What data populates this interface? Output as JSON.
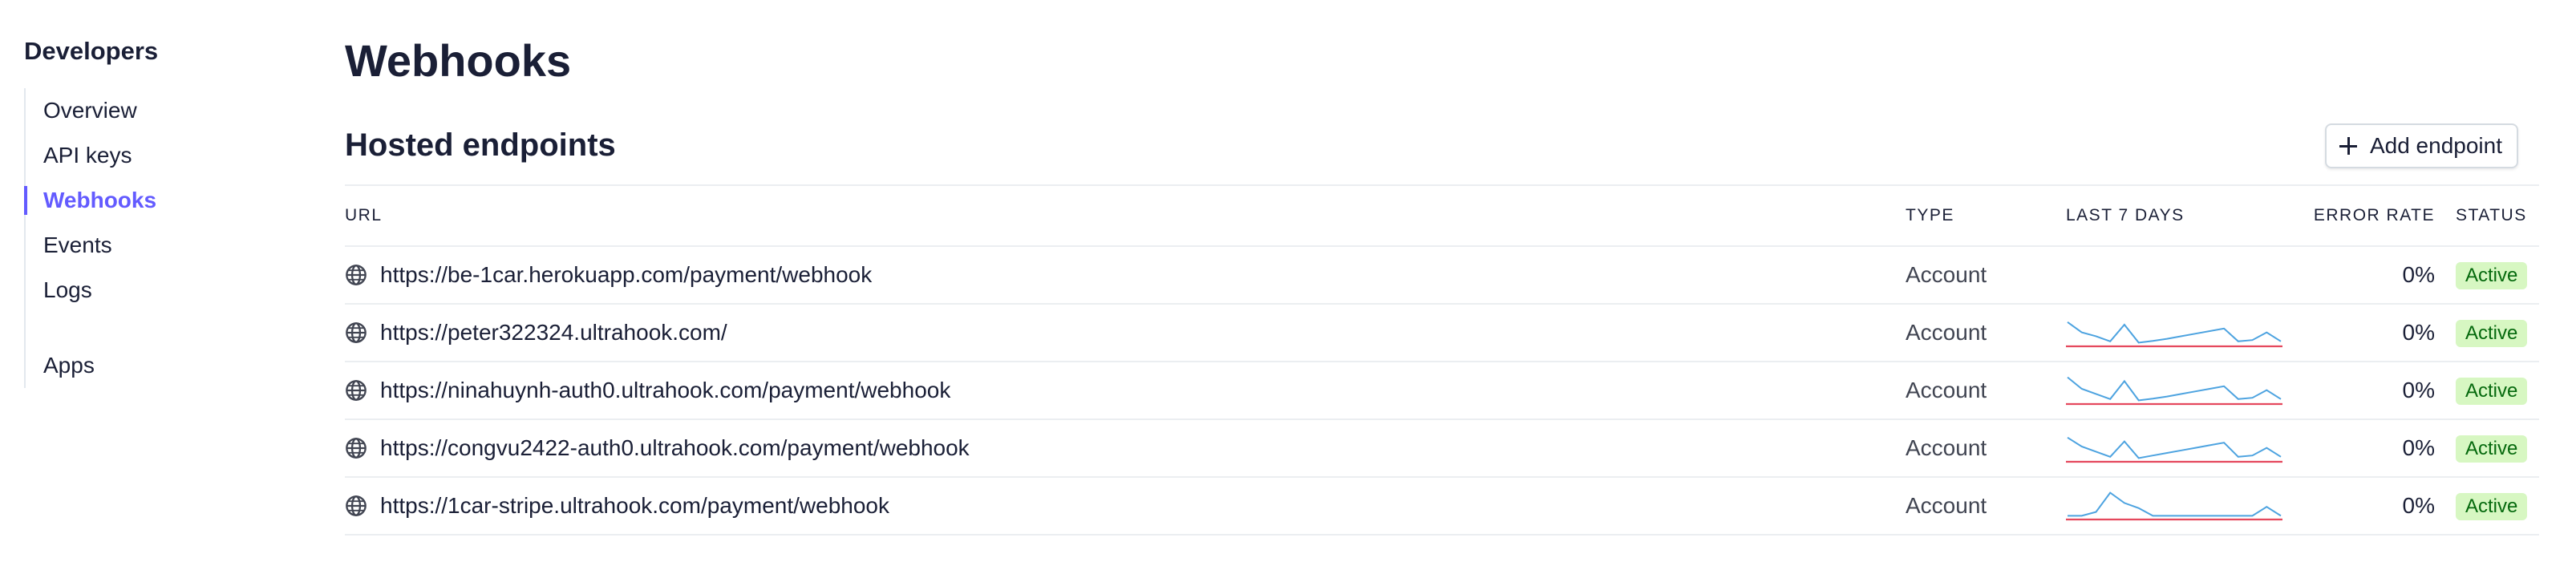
{
  "sidebar": {
    "title": "Developers",
    "items": [
      {
        "label": "Overview",
        "active": false
      },
      {
        "label": "API keys",
        "active": false
      },
      {
        "label": "Webhooks",
        "active": true
      },
      {
        "label": "Events",
        "active": false
      },
      {
        "label": "Logs",
        "active": false
      }
    ],
    "apps_label": "Apps"
  },
  "main": {
    "title": "Webhooks",
    "section_title": "Hosted endpoints",
    "add_button_label": "Add endpoint",
    "columns": {
      "url": "URL",
      "type": "TYPE",
      "last7": "LAST 7 DAYS",
      "error_rate": "ERROR RATE",
      "status": "STATUS"
    },
    "rows": [
      {
        "url": "https://be-1car.herokuapp.com/payment/webhook",
        "type": "Account",
        "error_rate": "0%",
        "status": "Active",
        "spark": null
      },
      {
        "url": "https://peter322324.ultrahook.com/",
        "type": "Account",
        "error_rate": "0%",
        "status": "Active",
        "spark": [
          0.85,
          0.45,
          0.3,
          0.1,
          0.75,
          0.05,
          0.12,
          0.2,
          0.3,
          0.4,
          0.5,
          0.6,
          0.1,
          0.15,
          0.45,
          0.1
        ]
      },
      {
        "url": "https://ninahuynh-auth0.ultrahook.com/payment/webhook",
        "type": "Account",
        "error_rate": "0%",
        "status": "Active",
        "spark": [
          0.95,
          0.5,
          0.3,
          0.1,
          0.8,
          0.05,
          0.12,
          0.2,
          0.3,
          0.4,
          0.5,
          0.6,
          0.1,
          0.15,
          0.45,
          0.1
        ]
      },
      {
        "url": "https://congvu2422-auth0.ultrahook.com/payment/webhook",
        "type": "Account",
        "error_rate": "0%",
        "status": "Active",
        "spark": [
          0.85,
          0.5,
          0.3,
          0.1,
          0.7,
          0.05,
          0.15,
          0.25,
          0.35,
          0.45,
          0.55,
          0.65,
          0.1,
          0.15,
          0.45,
          0.1
        ]
      },
      {
        "url": "https://1car-stripe.ultrahook.com/payment/webhook",
        "type": "Account",
        "error_rate": "0%",
        "status": "Active",
        "spark": [
          0.05,
          0.05,
          0.2,
          0.95,
          0.55,
          0.35,
          0.05,
          0.05,
          0.05,
          0.05,
          0.05,
          0.05,
          0.05,
          0.05,
          0.4,
          0.05
        ]
      }
    ]
  },
  "colors": {
    "accent": "#635bff",
    "spark_line": "#4da3e0",
    "error_line": "#e5485d",
    "badge_bg": "#d7f7c2",
    "badge_text": "#05690d"
  }
}
